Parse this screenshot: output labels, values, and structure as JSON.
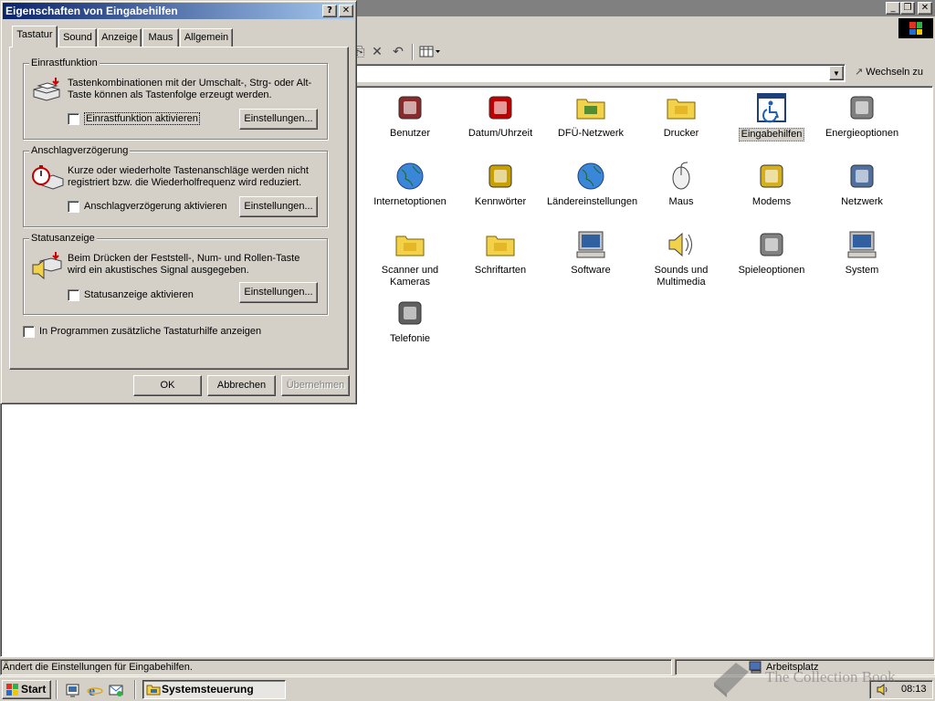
{
  "dialog": {
    "title": "Eigenschaften von Eingabehilfen",
    "help_glyph": "?",
    "close_glyph": "✕",
    "tabs": [
      {
        "label": "Tastatur"
      },
      {
        "label": "Sound"
      },
      {
        "label": "Anzeige"
      },
      {
        "label": "Maus"
      },
      {
        "label": "Allgemein"
      }
    ],
    "groups": [
      {
        "title": "Einrastfunktion",
        "description": "Tastenkombinationen mit der Umschalt-, Strg- oder Alt-Taste können als Tastenfolge erzeugt werden.",
        "checkbox_label": "Einrastfunktion aktivieren",
        "checked": false,
        "settings_label": "Einstellungen..."
      },
      {
        "title": "Anschlagverzögerung",
        "description": "Kurze oder wiederholte Tastenanschläge werden nicht registriert bzw. die Wiederholfrequenz wird reduziert.",
        "checkbox_label": "Anschlagverzögerung aktivieren",
        "checked": false,
        "settings_label": "Einstellungen..."
      },
      {
        "title": "Statusanzeige",
        "description": "Beim Drücken der Feststell-, Num- und Rollen-Taste wird ein akustisches Signal ausgegeben.",
        "checkbox_label": "Statusanzeige aktivieren",
        "checked": false,
        "settings_label": "Einstellungen..."
      }
    ],
    "extra_checkbox_label": "In Programmen zusätzliche Tastaturhilfe anzeigen",
    "buttons": {
      "ok": "OK",
      "cancel": "Abbrechen",
      "apply": "Übernehmen"
    }
  },
  "explorer": {
    "address_button": "Wechseln zu",
    "status_text": "Ändert die Einstellungen für Eingabehilfen.",
    "status_zone": "Arbeitsplatz",
    "items": [
      {
        "label": "Benutzer",
        "icon": "users-icon"
      },
      {
        "label": "Datum/Uhrzeit",
        "icon": "date-time-icon"
      },
      {
        "label": "DFÜ-Netzwerk",
        "icon": "dialup-network-icon"
      },
      {
        "label": "Drucker",
        "icon": "printer-folder-icon"
      },
      {
        "label": "Eingabehilfen",
        "icon": "accessibility-icon"
      },
      {
        "label": "Energieoptionen",
        "icon": "power-options-icon"
      },
      {
        "label": "Internetoptionen",
        "icon": "internet-options-icon"
      },
      {
        "label": "Kennwörter",
        "icon": "keys-icon"
      },
      {
        "label": "Ländereinstellungen",
        "icon": "globe-icon"
      },
      {
        "label": "Maus",
        "icon": "mouse-icon"
      },
      {
        "label": "Modems",
        "icon": "modem-phone-icon"
      },
      {
        "label": "Netzwerk",
        "icon": "network-icon"
      },
      {
        "label": "Scanner und Kameras",
        "icon": "scanner-camera-icon"
      },
      {
        "label": "Schriftarten",
        "icon": "fonts-folder-icon"
      },
      {
        "label": "Software",
        "icon": "software-icon"
      },
      {
        "label": "Sounds und Multimedia",
        "icon": "speaker-icon"
      },
      {
        "label": "Spieleoptionen",
        "icon": "joystick-icon"
      },
      {
        "label": "System",
        "icon": "computer-icon"
      },
      {
        "label": "Telefonie",
        "icon": "telephony-icon"
      }
    ],
    "selected_item": "Eingabehilfen"
  },
  "taskbar": {
    "start_label": "Start",
    "task_label": "Systemsteuerung",
    "clock": "08:13"
  },
  "watermark": "The Collection Book"
}
